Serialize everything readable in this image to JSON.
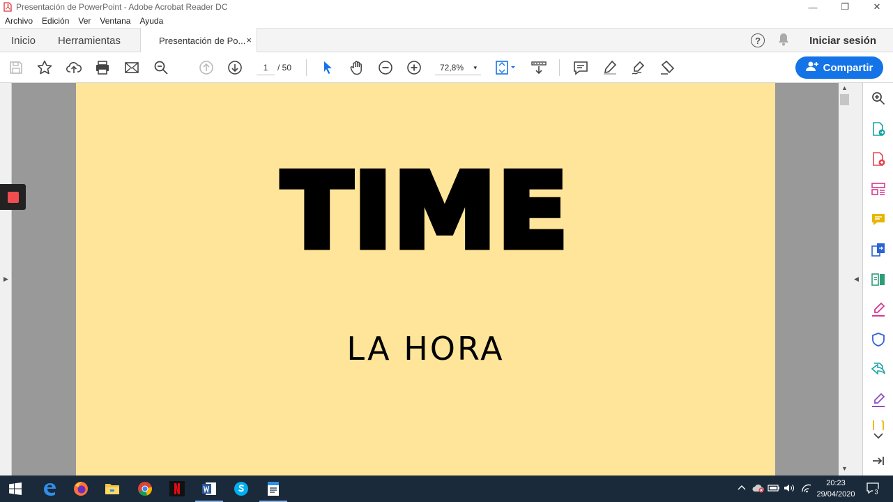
{
  "window": {
    "title": "Presentación de PowerPoint - Adobe Acrobat Reader DC",
    "minimize": "—",
    "restore": "❐",
    "close": "✕"
  },
  "menu": [
    "Archivo",
    "Edición",
    "Ver",
    "Ventana",
    "Ayuda"
  ],
  "tabs": {
    "home": "Inicio",
    "tools": "Herramientas",
    "document": "Presentación de Po...",
    "close": "×"
  },
  "account": {
    "help": "?",
    "signin": "Iniciar sesión"
  },
  "toolbar": {
    "page_current": "1",
    "page_total": "/ 50",
    "zoom": "72,8%",
    "zoom_caret": "▾",
    "share_label": "Compartir"
  },
  "document": {
    "title": "TIME",
    "subtitle": "LA HORA",
    "background": "#ffe599"
  },
  "taskbar": {
    "apps": [
      "windows-start",
      "edge",
      "firefox",
      "file-explorer",
      "chrome",
      "netflix",
      "word",
      "skype",
      "acrobat-reader"
    ],
    "time": "20:23",
    "date": "29/04/2020",
    "notifications": "3"
  },
  "colors": {
    "accent": "#1473e6",
    "record": "#f04e4e"
  }
}
